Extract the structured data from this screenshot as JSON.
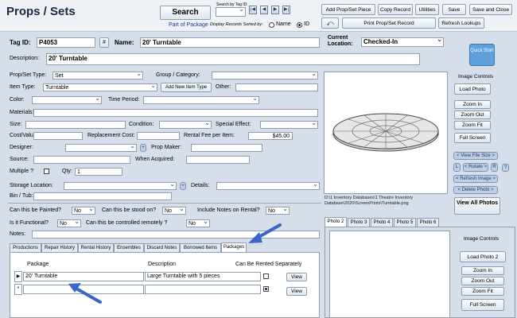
{
  "header": {
    "title": "Props / Sets",
    "search_label": "Search",
    "search_by_tag_label": "Search by Tag ID:",
    "part_of_package": "Part of Package",
    "display_sorted_label": "Display Records Sorted by:",
    "sort_name": "Name",
    "sort_id": "ID",
    "nav_first": "|◀",
    "nav_prev": "◀",
    "nav_next": "▶",
    "nav_last": "▶|",
    "add_button": "Add Prop/Set Piece",
    "copy_button": "Copy Record",
    "utilities_button": "Utilities",
    "save_button": "Save",
    "save_close_button": "Save and Close",
    "print_button": "Print Prop/Set Record",
    "refresh_button": "Refresh Lookups"
  },
  "record": {
    "tag_id_label": "Tag ID:",
    "tag_id": "P4053",
    "hash": "#",
    "name_label": "Name:",
    "name": "20' Turntable",
    "current_location_label": "Current Location:",
    "current_location": "Checked-In",
    "description_label": "Description:",
    "description": "20' Turntable",
    "quick_start": "Quick Start"
  },
  "form": {
    "type_label": "Prop/Set Type:",
    "type_value": "Set",
    "group_label": "Group / Category:",
    "item_type_label": "Item Type:",
    "item_type_value": "Turntable",
    "add_item_type": "Add New Item Type",
    "other_label": "Other:",
    "color_label": "Color:",
    "time_period_label": "Time Period:",
    "materials_label": "Materials:",
    "size_label": "Size:",
    "condition_label": "Condition:",
    "special_effect_label": "Special Effect:",
    "cost_label": "Cost/Value:",
    "replacement_label": "Replacement Cost:",
    "rental_fee_label": "Rental Fee per Item:",
    "rental_fee_value": "$45.00",
    "designer_label": "Designer:",
    "prop_maker_label": "Prop Maker:",
    "source_label": "Source:",
    "when_acquired_label": "When Acquired:",
    "multiple_label": "Multiple ?",
    "qty_label": "Qty:",
    "qty_value": "1",
    "storage_label": "Storage Location:",
    "details_label": "Details:",
    "bin_label": "Bin / Tub:",
    "painted_label": "Can this be Painted?",
    "painted_value": "No",
    "stood_label": "Can this be stood on?",
    "stood_value": "No",
    "notes_rental_label": "Include Notes on Rental?",
    "notes_rental_value": "No",
    "functional_label": "Is it Functional?",
    "functional_value": "No",
    "remote_label": "Can this be controlled remotely ?",
    "remote_value": "No",
    "notes_label": "Notes:",
    "plus": "+"
  },
  "tabs": [
    "Productions",
    "Repair History",
    "Rental History",
    "Ensembles",
    "Discard Notes",
    "Borrowed Items",
    "Packages"
  ],
  "packages": {
    "col_package": "Package",
    "col_description": "Description",
    "col_rented_separately": "Can Be Rented Separately",
    "rows": [
      {
        "package": "20' Turntable",
        "description": "Large Turntable with 5 pieces",
        "view": "View"
      },
      {
        "package": "",
        "description": "",
        "view": "View"
      }
    ]
  },
  "image_panel": {
    "path": "D:\\1 Inventory Databases\\1 Theatre Inventory Database\\2020\\ScreenPrints\\Turntable.png",
    "image_controls": "Image Controls",
    "load_photo": "Load Photo",
    "zoom_in": "Zoom In",
    "zoom_out": "Zoom Out",
    "zoom_fit": "Zoom Fit",
    "full_screen": "Full Screen",
    "view_file_size": "< View File Size >",
    "l": "L",
    "rotate": "< Rotate >",
    "r": "R",
    "question": "?",
    "refresh_image": "< Refresh Image >",
    "delete_photo": "< Delete Photo >",
    "view_all_photos": "View All Photos"
  },
  "photo_tabs": [
    "Photo 2",
    "Photo 3",
    "Photo 4",
    "Photo 5",
    "Photo 6"
  ],
  "photo2_panel": {
    "image_controls": "Image Controls",
    "load_photo2": "Load Photo 2",
    "zoom_in": "Zoom In",
    "zoom_out": "Zoom Out",
    "zoom_fit": "Zoom Fit",
    "full_screen": "Full Screen"
  },
  "colors": {
    "background": "#d6dfe9",
    "arrow": "#3a66c8",
    "title": "#1b2b3f"
  }
}
